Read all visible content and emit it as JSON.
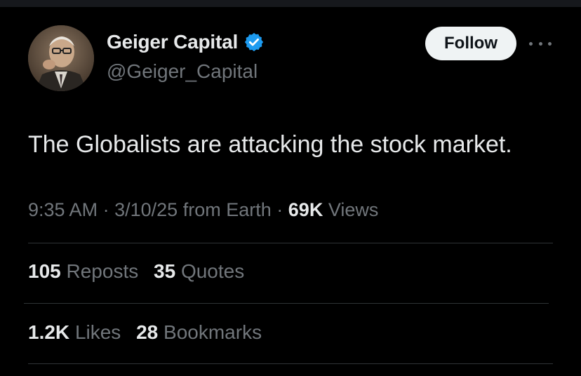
{
  "author": {
    "name": "Geiger Capital",
    "handle": "@Geiger_Capital",
    "verified": true,
    "verified_color": "#1d9bf0"
  },
  "follow_label": "Follow",
  "more_icon": "more-horizontal-icon",
  "tweet": {
    "text": "The Globalists are attacking the stock market."
  },
  "meta": {
    "time": "9:35 AM",
    "separator": "·",
    "date": "3/10/25",
    "source": "from Earth",
    "views_count": "69K",
    "views_label": "Views"
  },
  "stats_row1": [
    {
      "count": "105",
      "label": "Reposts"
    },
    {
      "count": "35",
      "label": "Quotes"
    }
  ],
  "stats_row2": [
    {
      "count": "1.2K",
      "label": "Likes"
    },
    {
      "count": "28",
      "label": "Bookmarks"
    }
  ],
  "colors": {
    "background": "#000000",
    "text_primary": "#e7e9ea",
    "text_secondary": "#71767b",
    "divider": "#2f3336",
    "follow_bg": "#eff3f4"
  }
}
